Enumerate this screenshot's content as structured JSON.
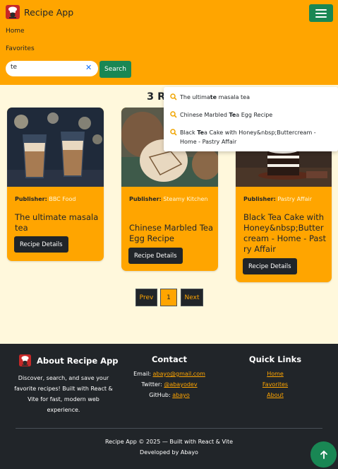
{
  "app": {
    "title": "Recipe App"
  },
  "nav": {
    "home": "Home",
    "favorites": "Favorites"
  },
  "search": {
    "value": "te",
    "button": "Search"
  },
  "results": {
    "heading": "3 R"
  },
  "suggestions": [
    {
      "pre": "The ultima",
      "match": "te",
      "post": " masala tea"
    },
    {
      "pre": "Chinese Marbled ",
      "match": "Te",
      "post": "a Egg Recipe"
    },
    {
      "pre": "Black ",
      "match": "Te",
      "post": "a Cake with Honey&nbsp;Buttercream - Home - Pastry Affair"
    }
  ],
  "cards": [
    {
      "publisher_label": "Publisher:",
      "publisher": "BBC Food",
      "title": "The ultimate masala tea",
      "button": "Recipe Details"
    },
    {
      "publisher_label": "Publisher:",
      "publisher": "Steamy Kitchen",
      "title": "Chinese Marbled Tea Egg Recipe",
      "button": "Recipe Details"
    },
    {
      "publisher_label": "Publisher:",
      "publisher": "Pastry Affair",
      "title": "Black Tea Cake with Honey&nbsp;Buttercream - Home - Pastry Affair",
      "button": "Recipe Details"
    }
  ],
  "pagination": {
    "prev": "Prev",
    "current": "1",
    "next": "Next"
  },
  "footer": {
    "about_title": "About Recipe App",
    "about_text": "Discover, search, and save your favorite recipes! Built with React & Vite for fast, modern web experience.",
    "contact_title": "Contact",
    "email_label": "Email:",
    "email": "abayo@gmail.com",
    "twitter_label": "Twitter:",
    "twitter": "@abayodev",
    "github_label": "GitHub:",
    "github": "abayo",
    "quick_title": "Quick Links",
    "links": [
      "Home",
      "Favorites",
      "About"
    ],
    "copyright": "Recipe App © 2025 — Built with React & Vite",
    "developer": "Developed by Abayo"
  },
  "colors": {
    "primary": "#ffa500",
    "success": "#198754",
    "dark": "#212529",
    "background": "#fff8dc",
    "link": "#ffa500"
  }
}
